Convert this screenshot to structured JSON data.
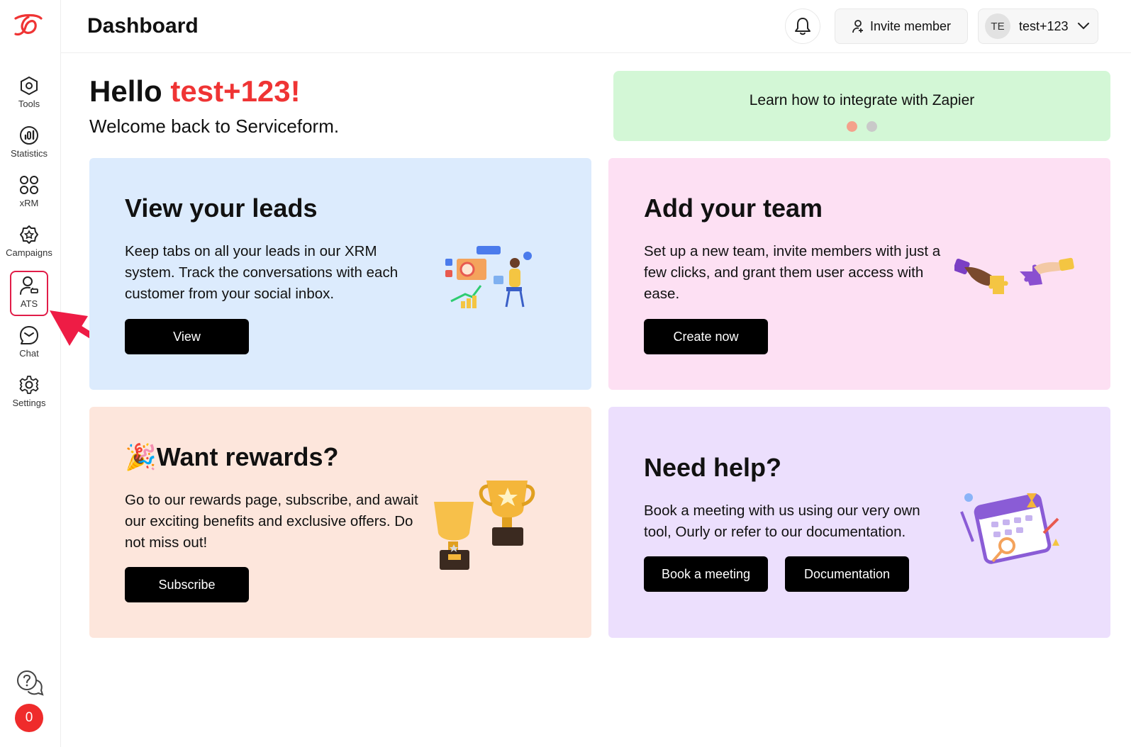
{
  "header": {
    "title": "Dashboard",
    "invite_label": "Invite member",
    "avatar_initials": "TE",
    "user_name": "test+123"
  },
  "sidebar": {
    "items": [
      {
        "label": "Tools",
        "icon": "tools-icon"
      },
      {
        "label": "Statistics",
        "icon": "statistics-icon"
      },
      {
        "label": "xRM",
        "icon": "xrm-grid-icon"
      },
      {
        "label": "Campaigns",
        "icon": "campaigns-icon"
      },
      {
        "label": "ATS",
        "icon": "ats-user-icon",
        "active": true
      },
      {
        "label": "Chat",
        "icon": "chat-icon"
      },
      {
        "label": "Settings",
        "icon": "gear-icon"
      }
    ],
    "notification_count": "0"
  },
  "greeting": {
    "hello": "Hello ",
    "user": "test+123!",
    "welcome": "Welcome back to Serviceform."
  },
  "banner": {
    "text": "Learn how to integrate with Zapier",
    "active_dot_color": "#f4a18c",
    "inactive_dot_color": "#c9c9c9"
  },
  "cards": {
    "leads": {
      "title": "View your leads",
      "text": "Keep tabs on all your leads in our XRM system. Track the conversations with each customer from your social inbox.",
      "button": "View",
      "bg": "#dcebfd"
    },
    "team": {
      "title": "Add your team",
      "text": "Set up a new team, invite members with just a few clicks, and grant them user access with ease.",
      "button": "Create now",
      "bg": "#fde0f3"
    },
    "rewards": {
      "emoji": "🎉",
      "title": "Want rewards?",
      "text": "Go to our rewards page, subscribe, and await our exciting benefits and exclusive offers. Do not miss out!",
      "button": "Subscribe",
      "bg": "#fde6dc"
    },
    "help": {
      "title": "Need help?",
      "text": "Book a meeting with us using our very own tool, Ourly or refer to our documentation.",
      "button_meeting": "Book a meeting",
      "button_docs": "Documentation",
      "bg": "#ecdffd"
    }
  },
  "colors": {
    "accent": "#ef3434",
    "highlight": "#e11d48"
  }
}
